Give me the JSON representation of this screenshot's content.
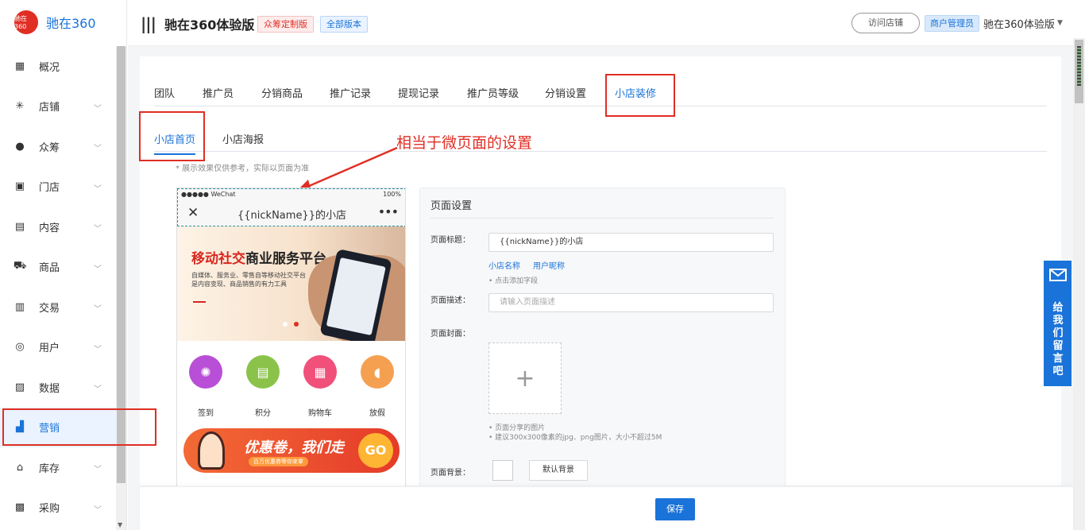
{
  "brand": {
    "logo_text": "驰在360",
    "name": "驰在360"
  },
  "sidebar": {
    "items": [
      {
        "label": "概况",
        "icon": "dashboard-icon"
      },
      {
        "label": "店铺",
        "icon": "shop-icon"
      },
      {
        "label": "众筹",
        "icon": "crowdfunding-icon"
      },
      {
        "label": "门店",
        "icon": "store-icon"
      },
      {
        "label": "内容",
        "icon": "content-icon"
      },
      {
        "label": "商品",
        "icon": "cart-icon"
      },
      {
        "label": "交易",
        "icon": "trade-icon"
      },
      {
        "label": "用户",
        "icon": "users-icon"
      },
      {
        "label": "数据",
        "icon": "data-icon"
      },
      {
        "label": "营销",
        "icon": "marketing-icon"
      },
      {
        "label": "库存",
        "icon": "warehouse-icon"
      },
      {
        "label": "采购",
        "icon": "purchase-icon"
      }
    ],
    "active": "营销"
  },
  "header": {
    "title": "驰在360体验版",
    "tag1": "众筹定制版",
    "tag2": "全部版本",
    "visit_store": "访问店铺",
    "role": "商户管理员",
    "shop_name": "驰在360体验版"
  },
  "tabs": [
    "团队",
    "推广员",
    "分销商品",
    "推广记录",
    "提现记录",
    "推广员等级",
    "分销设置",
    "小店装修"
  ],
  "active_tab": "小店装修",
  "subtabs": [
    "小店首页",
    "小店海报"
  ],
  "active_subtab": "小店首页",
  "annotation": "相当于微页面的设置",
  "note": "* 展示效果仅供参考，实际以页面为准",
  "preview": {
    "carrier": "●●●●● WeChat",
    "battery": "100%",
    "page_title": "{{nickName}}的小店",
    "banner_headline_red": "移动社交",
    "banner_headline_black": "商业服务平台",
    "banner_sub1": "自媒体、服务业、零售自等移动社交平台",
    "banner_sub2": "是内容变现、商品销售的有力工具",
    "icons": [
      {
        "label": "签到",
        "color": "#b84fd6"
      },
      {
        "label": "积分",
        "color": "#8bc34a"
      },
      {
        "label": "购物车",
        "color": "#f0507a"
      },
      {
        "label": "放假",
        "color": "#f5a050"
      }
    ],
    "coupon_text": "优惠卷，我们走",
    "coupon_small": "百万优惠券等你来拿",
    "coupon_go": "GO"
  },
  "settings": {
    "header": "页面设置",
    "title_label": "页面标题：",
    "title_value": "{{nickName}}的小店",
    "link_shop_name": "小店名称",
    "link_nickname": "用户昵称",
    "add_field_hint": "• 点击添加字段",
    "desc_label": "页面描述：",
    "desc_placeholder": "请输入页面描述",
    "cover_label": "页面封面：",
    "cover_hint1": "• 页面分享的图片",
    "cover_hint2": "• 建议300x300像素的jpg、png图片，大小不超过5M",
    "bg_label": "页面背景：",
    "default_bg": "默认背景"
  },
  "footer": {
    "save": "保存"
  },
  "feedback": {
    "text": "给我们留言吧"
  }
}
